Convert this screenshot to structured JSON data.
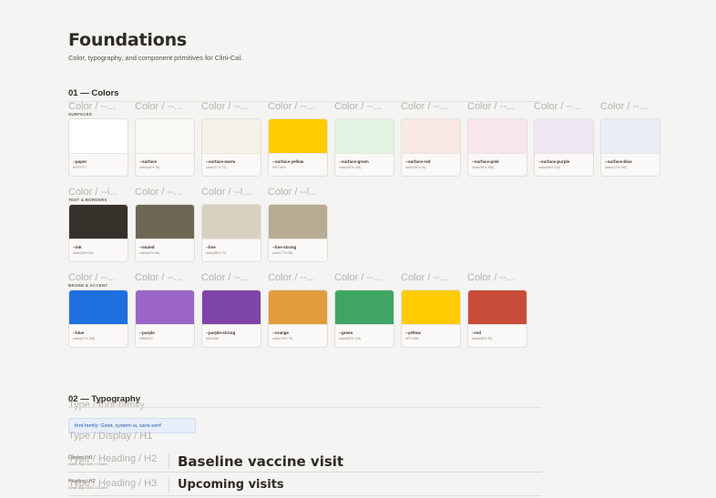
{
  "header": {
    "title": "Foundations",
    "subtitle": "Color, typography, and component primitives for Clini-Cal."
  },
  "colors": {
    "section_title": "01 — Colors",
    "ghost_label": "Color / --...",
    "groups": [
      {
        "label": "SURFACES",
        "ghosts": [
          "Color / --...",
          "Color / --...",
          "Color / --...",
          "Color / --...",
          "Color / --...",
          "Color / --...",
          "Color / --...",
          "Color / --...",
          "Color / --..."
        ],
        "swatches": [
          {
            "name": "--paper",
            "value": "#FFFFFF",
            "color": "#ffffff"
          },
          {
            "name": "--surface",
            "value": "oklch(99% 76)",
            "color": "#faf9f5"
          },
          {
            "name": "--surface-warm",
            "value": "oklch(97% 72)",
            "color": "#f5f2e8"
          },
          {
            "name": "--surface-yellow",
            "value": "#FFC800",
            "color": "#ffcc00"
          },
          {
            "name": "--surface-green",
            "value": "oklch(95% 148)",
            "color": "#e2f4e2"
          },
          {
            "name": "--surface-red",
            "value": "oklch(96% 30)",
            "color": "#f8e9e4"
          },
          {
            "name": "--surface-pink",
            "value": "oklch(96% 356)",
            "color": "#f8e6ee"
          },
          {
            "name": "--surface-purple",
            "value": "oklch(95% 310)",
            "color": "#efe6f6"
          },
          {
            "name": "--surface-blue",
            "value": "oklch(97% 240)",
            "color": "#e9eef8"
          }
        ]
      },
      {
        "label": "TEXT & BORDERS",
        "ghosts": [
          "Color / --i...",
          "Color / --...",
          "Color / --l...",
          "Color / --l..."
        ],
        "swatches": [
          {
            "name": "--ink",
            "value": "oklch(28% 62)",
            "color": "#36312a"
          },
          {
            "name": "--muted",
            "value": "oklch(50% 68)",
            "color": "#6e6655"
          },
          {
            "name": "--line",
            "value": "oklch(88% 72)",
            "color": "#d8d1c2"
          },
          {
            "name": "--line-strong",
            "value": "oklch(77% 68)",
            "color": "#b8ab94"
          }
        ]
      },
      {
        "label": "BRAND & ACCENT",
        "ghosts": [
          "Color / --...",
          "Color / --...",
          "Color / --...",
          "Color / --...",
          "Color / --...",
          "Color / --...",
          "Color / --..."
        ],
        "swatches": [
          {
            "name": "--blue",
            "value": "oklch(57% 258)",
            "color": "#1e6fe0"
          },
          {
            "name": "--purple",
            "value": "#9B65C8",
            "color": "#9b65c8"
          },
          {
            "name": "--purple-strong",
            "value": "#8044A8",
            "color": "#7f44aa"
          },
          {
            "name": "--orange",
            "value": "oklch(73% 70)",
            "color": "#e09c3c"
          },
          {
            "name": "--green",
            "value": "oklch(63% 149)",
            "color": "#3fa564"
          },
          {
            "name": "--yellow",
            "value": "#FFC800",
            "color": "#ffcc00"
          },
          {
            "name": "--red",
            "value": "oklch(58% 29)",
            "color": "#c84c3a"
          }
        ]
      }
    ]
  },
  "typography": {
    "section_title": "02 — Typography",
    "ghost_family": "Type / font-family",
    "font_chip": "font-family: Geist, system-ui, sans-serif",
    "ghost_display": "Type / Display / H1",
    "rows": [
      {
        "meta1": "Display / H1",
        "meta2": "Geist 22px 600 -0.02em",
        "ghost": "Type / Heading / H2",
        "sample": "Baseline vaccine visit"
      },
      {
        "meta1": "Heading / H2",
        "meta2": "Geist 16px 600 -0.01em",
        "ghost": "Type / Heading / H3",
        "sample": "Upcoming visits"
      }
    ]
  }
}
